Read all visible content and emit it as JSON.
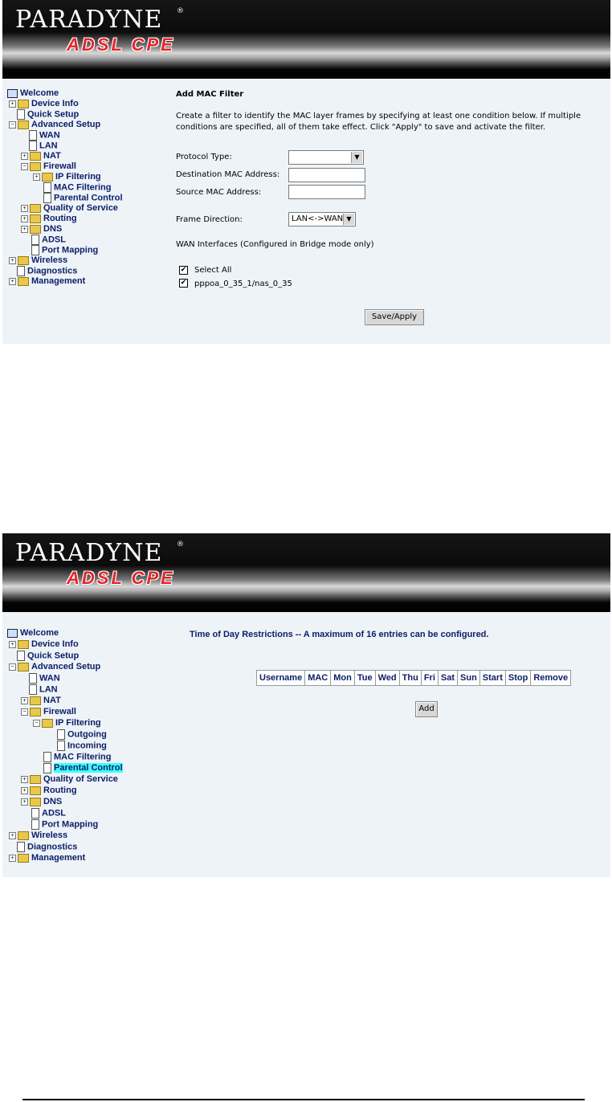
{
  "brand": {
    "logo": "PARADYNE",
    "reg": "®",
    "product": "ADSL CPE"
  },
  "screen1": {
    "nav": [
      "Welcome",
      "Device Info",
      "Quick Setup",
      "Advanced Setup",
      "WAN",
      "LAN",
      "NAT",
      "Firewall",
      "IP Filtering",
      "MAC Filtering",
      "Parental Control",
      "Quality of Service",
      "Routing",
      "DNS",
      "ADSL",
      "Port Mapping",
      "Wireless",
      "Diagnostics",
      "Management"
    ],
    "title": "Add MAC Filter",
    "description": "Create a filter to identify the MAC layer frames by specifying at least one condition below. If multiple conditions are specified, all of them take effect. Click \"Apply\" to save and activate the filter.",
    "protocol_label": "Protocol Type:",
    "protocol_value": "",
    "dest_mac_label": "Destination MAC Address:",
    "dest_mac_value": "",
    "src_mac_label": "Source MAC Address:",
    "src_mac_value": "",
    "direction_label": "Frame Direction:",
    "direction_value": "LAN<->WAN",
    "wan_note": "WAN Interfaces (Configured in Bridge mode only)",
    "select_all_label": "Select All",
    "select_all_checked": true,
    "interface_label": "pppoa_0_35_1/nas_0_35",
    "interface_checked": true,
    "save_label": "Save/Apply"
  },
  "screen2": {
    "nav": [
      "Welcome",
      "Device Info",
      "Quick Setup",
      "Advanced Setup",
      "WAN",
      "LAN",
      "NAT",
      "Firewall",
      "IP Filtering",
      "Outgoing",
      "Incoming",
      "MAC Filtering",
      "Parental Control",
      "Quality of Service",
      "Routing",
      "DNS",
      "ADSL",
      "Port Mapping",
      "Wireless",
      "Diagnostics",
      "Management"
    ],
    "selected": "Parental Control",
    "title": "Time of Day Restrictions -- A maximum of 16 entries can be configured.",
    "columns": [
      "Username",
      "MAC",
      "Mon",
      "Tue",
      "Wed",
      "Thu",
      "Fri",
      "Sat",
      "Sun",
      "Start",
      "Stop",
      "Remove"
    ],
    "add_label": "Add"
  },
  "check_mark": "✔",
  "expander_plus": "+",
  "expander_minus": "−",
  "arrow_down": "▼"
}
